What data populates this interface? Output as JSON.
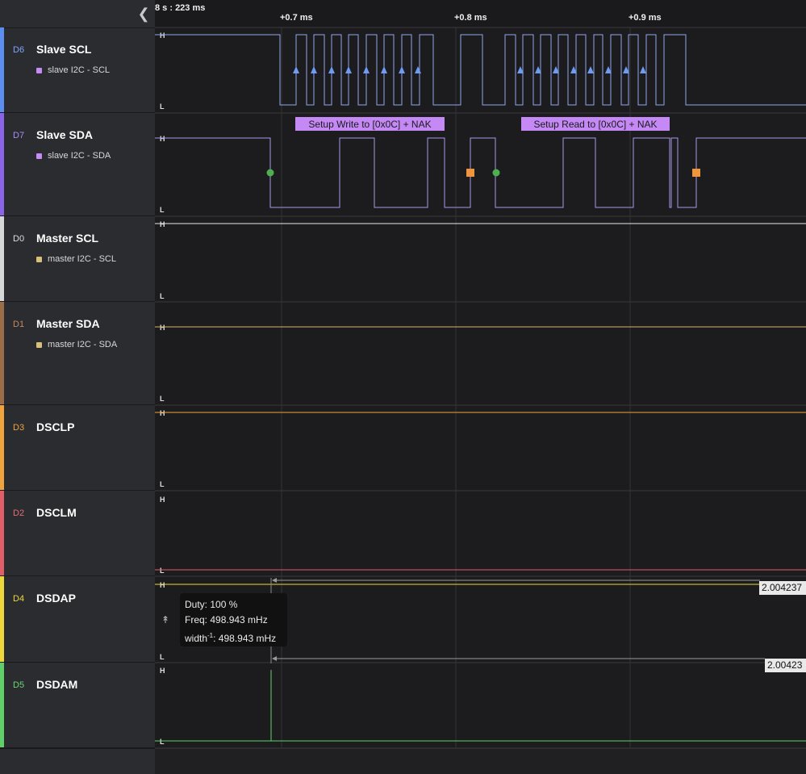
{
  "timeline": {
    "start_label": "8 s : 223 ms",
    "ticks": [
      "+0.7 ms",
      "+0.8 ms",
      "+0.9 ms"
    ]
  },
  "sidebar": {
    "collapse_icon": "chevron-left-icon",
    "channels": [
      {
        "id": "D6",
        "name": "Slave SCL",
        "color": "#5b8ef0",
        "id_color": "#7ea6ff",
        "analyzer": "slave I2C - SCL",
        "analyzer_color": "#c58cf4"
      },
      {
        "id": "D7",
        "name": "Slave SDA",
        "color": "#8a63e8",
        "id_color": "#a78bfa",
        "analyzer": "slave I2C - SDA",
        "analyzer_color": "#c58cf4"
      },
      {
        "id": "D0",
        "name": "Master SCL",
        "color": "#d6d6d6",
        "id_color": "#dddddd",
        "analyzer": "master I2C - SCL",
        "analyzer_color": "#d9c07a"
      },
      {
        "id": "D1",
        "name": "Master SDA",
        "color": "#9a6d48",
        "id_color": "#c08a5f",
        "analyzer": "master I2C - SDA",
        "analyzer_color": "#d9c07a"
      },
      {
        "id": "D3",
        "name": "DSCLP",
        "color": "#f0a33c",
        "id_color": "#f0a33c",
        "analyzer": ""
      },
      {
        "id": "D2",
        "name": "DSCLM",
        "color": "#e05d6a",
        "id_color": "#e86c78",
        "analyzer": ""
      },
      {
        "id": "D4",
        "name": "DSDAP",
        "color": "#ecd83b",
        "id_color": "#ecd83b",
        "analyzer": ""
      },
      {
        "id": "D5",
        "name": "DSDAM",
        "color": "#5fcf6a",
        "id_color": "#6ad674",
        "analyzer": ""
      }
    ]
  },
  "waveform": {
    "level_high": "H",
    "level_low": "L",
    "annotations": [
      "Setup Write to [0x0C] + NAK",
      "Setup Read to [0x0C] + NAK"
    ],
    "annotation_color": "#c589f5",
    "scl_signal_color": "#8fa6e8",
    "sda_signal_color": "#a797e8",
    "marker_start_color": "#4caf50",
    "marker_stop_color": "#f0953a"
  },
  "measurement": {
    "duty": "Duty: 100 %",
    "freq": "Freq: 498.943 mHz",
    "width_prefix": "width",
    "width_exp": "-1",
    "width_value": ": 498.943 mHz",
    "value_d4": "2.004237",
    "value_d5": "2.00423"
  }
}
